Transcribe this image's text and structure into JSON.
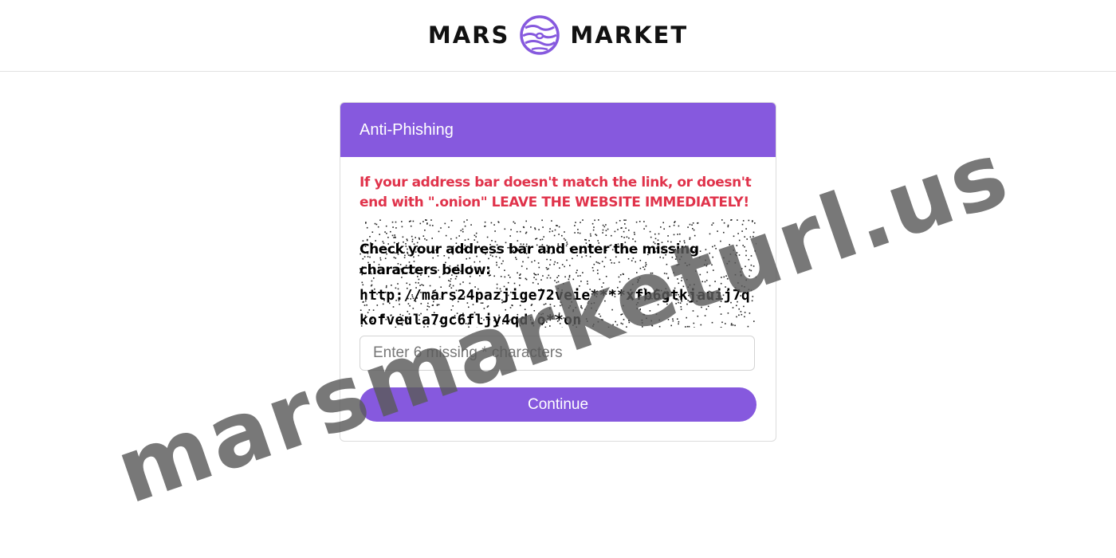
{
  "header": {
    "logo_left": "MARS",
    "logo_right": "MARKET"
  },
  "card": {
    "title": "Anti-Phishing",
    "captcha": {
      "warning": "If your address bar doesn't match the link, or doesn't end with \".onion\" LEAVE THE WEBSITE IMMEDIATELY!",
      "instruction": "Check your address bar and enter the missing characters below:",
      "url": "http://mars24pazjige72veie****xfb6gtkjauij7qkofveula7gc6fljy4qd.o**on"
    },
    "input": {
      "placeholder": "Enter 6 missing * characters",
      "value": ""
    },
    "continue_label": "Continue"
  },
  "watermark": "marsmarketurl.us",
  "colors": {
    "accent": "#8659de",
    "warning": "#e0334b"
  }
}
